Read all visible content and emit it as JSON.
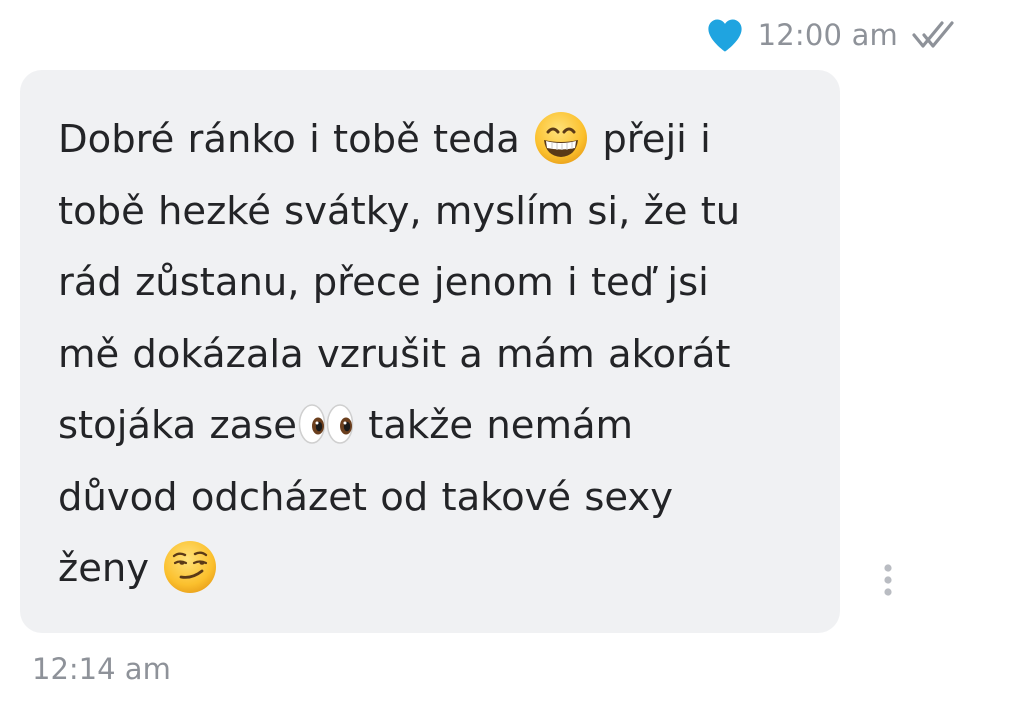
{
  "status": {
    "sent_time": "12:00 am",
    "reaction_icon": "heart-icon",
    "reaction_color": "#1fa4e0",
    "read_icon": "double-check-icon"
  },
  "message": {
    "lines": [
      {
        "before": "Dobré ránko i tobě teda ",
        "emoji": "grinning-face-emoji",
        "after": " přeji i"
      },
      {
        "text": "tobě hezké svátky, myslím si, že tu"
      },
      {
        "text": "rád zůstanu, přece jenom i teď jsi"
      },
      {
        "text": "mě dokázala vzrušit a mám akorát"
      },
      {
        "before": "stojáka zase",
        "emoji": "eyes-emoji",
        "after": " takže nemám"
      },
      {
        "text": "důvod odcházet od takové sexy"
      },
      {
        "before": "ženy ",
        "emoji": "smirking-face-emoji",
        "after": ""
      }
    ],
    "bubble_color": "#f0f1f3",
    "received_time": "12:14 am"
  },
  "menu": {
    "icon": "more-vertical-icon"
  }
}
